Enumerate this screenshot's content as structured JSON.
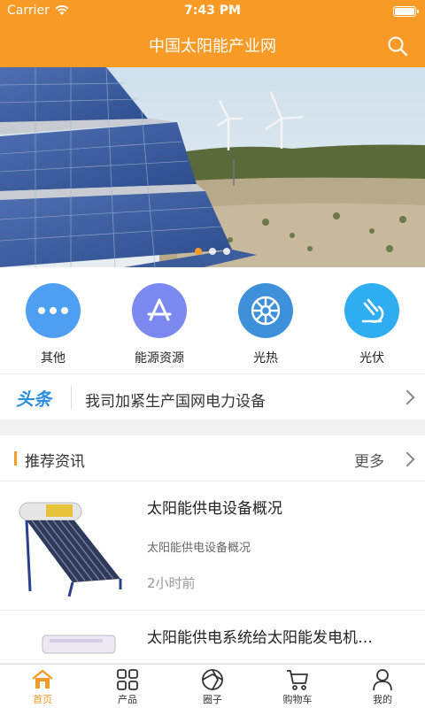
{
  "status": {
    "carrier": "Carrier",
    "time": "7:43 PM"
  },
  "header": {
    "title": "中国太阳能产业网"
  },
  "banner": {
    "slides": 3,
    "active_slide": 1
  },
  "categories": [
    {
      "label": "其他",
      "icon": "more-dots-icon",
      "color": "#4e9ff2"
    },
    {
      "label": "能源资源",
      "icon": "app-store-icon",
      "color": "#7b88f0"
    },
    {
      "label": "光热",
      "icon": "wheel-icon",
      "color": "#3f90db"
    },
    {
      "label": "光伏",
      "icon": "microscope-icon",
      "color": "#2eaef0"
    }
  ],
  "headline": {
    "tag": "头条",
    "text": "我司加紧生产国网电力设备"
  },
  "section": {
    "title": "推荐资讯",
    "more": "更多"
  },
  "news": [
    {
      "title": "太阳能供电设备概况",
      "summary": "太阳能供电设备概况",
      "time": "2小时前"
    },
    {
      "title": "太阳能供电系统给太阳能发电机…"
    }
  ],
  "tabs": [
    {
      "label": "首页",
      "icon": "home-icon"
    },
    {
      "label": "产品",
      "icon": "grid-icon"
    },
    {
      "label": "圈子",
      "icon": "circle-icon"
    },
    {
      "label": "购物车",
      "icon": "cart-icon"
    },
    {
      "label": "我的",
      "icon": "user-icon"
    }
  ],
  "colors": {
    "accent": "#f89a26",
    "headline_tag": "#2a8fe0"
  }
}
